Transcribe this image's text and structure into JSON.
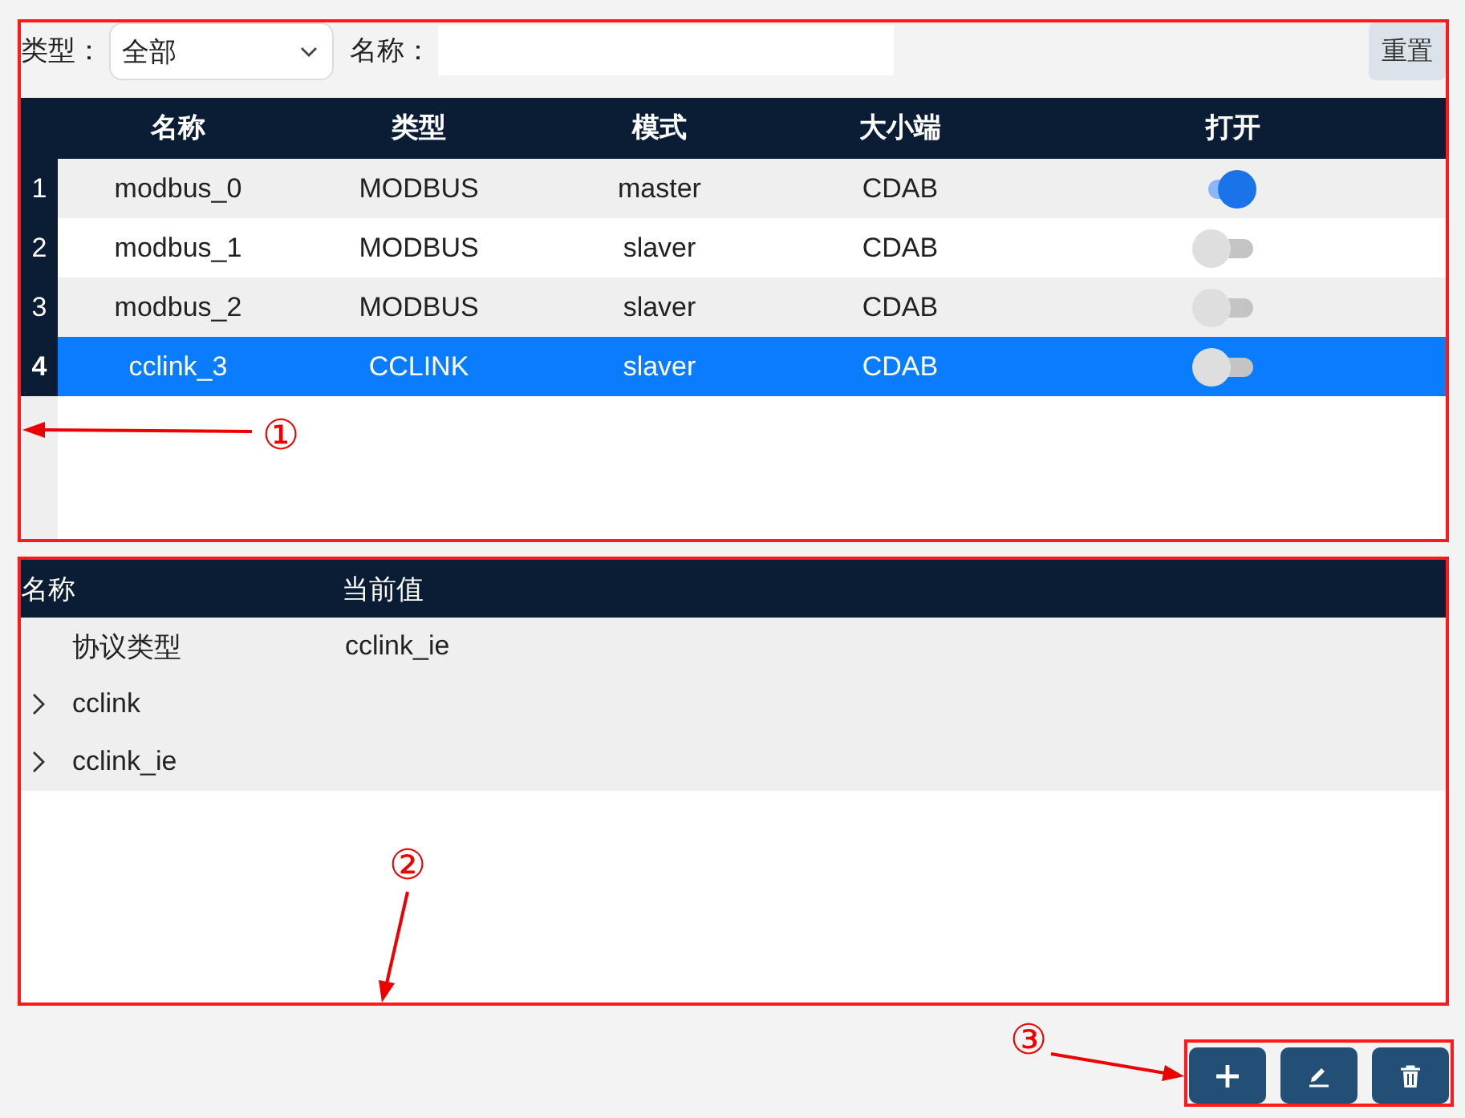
{
  "filter_bar": {
    "type_label": "类型：",
    "type_select": {
      "value": "全部"
    },
    "name_label": "名称：",
    "reset_button": "重置"
  },
  "device_table": {
    "columns": [
      "名称",
      "类型",
      "模式",
      "大小端",
      "打开"
    ],
    "rows": [
      {
        "number": "1",
        "name": "modbus_0",
        "type": "MODBUS",
        "mode": "master",
        "byte_order": "CDAB",
        "open": true,
        "selected": false
      },
      {
        "number": "2",
        "name": "modbus_1",
        "type": "MODBUS",
        "mode": "slaver",
        "byte_order": "CDAB",
        "open": false,
        "selected": false
      },
      {
        "number": "3",
        "name": "modbus_2",
        "type": "MODBUS",
        "mode": "slaver",
        "byte_order": "CDAB",
        "open": false,
        "selected": false
      },
      {
        "number": "4",
        "name": "cclink_3",
        "type": "CCLINK",
        "mode": "slaver",
        "byte_order": "CDAB",
        "open": false,
        "selected": true
      }
    ]
  },
  "property_table": {
    "columns": [
      "名称",
      "当前值"
    ],
    "items": [
      {
        "kind": "property",
        "name": "协议类型",
        "value": "cclink_ie"
      },
      {
        "kind": "group",
        "name": "cclink",
        "expanded": false
      },
      {
        "kind": "group",
        "name": "cclink_ie",
        "expanded": false
      }
    ]
  },
  "action_buttons": [
    {
      "kind": "add"
    },
    {
      "kind": "edit"
    },
    {
      "kind": "delete"
    }
  ],
  "annotations": [
    {
      "label": "①"
    },
    {
      "label": "②"
    },
    {
      "label": "③"
    }
  ]
}
